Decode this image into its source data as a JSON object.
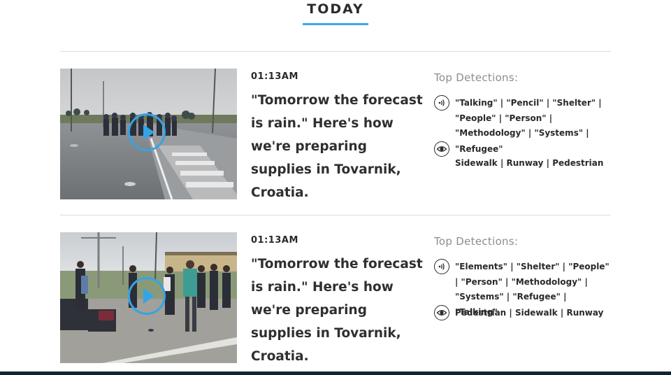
{
  "section": {
    "heading": "TODAY"
  },
  "cards": [
    {
      "time": "01:13AM",
      "title": "\"Tomorrow the forecast is rain.\" Here's how we're preparing supplies in Tovarnik, Croatia.",
      "detections_heading": "Top Detections:",
      "audio_detections": "\"Talking\" | \"Pencil\" | \"Shelter\" | \"People\" | \"Person\" | \"Methodology\" | \"Systems\" |",
      "visual_detections": "\"Refugee\"",
      "extra_detections": "Sidewalk | Runway | Pedestrian"
    },
    {
      "time": "01:13AM",
      "title": "\"Tomorrow the forecast is rain.\" Here's how we're preparing supplies in Tovarnik, Croatia.",
      "detections_heading": "Top Detections:",
      "audio_detections": "\"Elements\" | \"Shelter\" | \"People\" | \"Person\" | \"Methodology\" | \"Systems\" | \"Refugee\" | \"Talking\"",
      "visual_detections": "Pedestrian | Sidewalk | Runway"
    }
  ],
  "icons": {
    "audio": "audio-waves-icon",
    "visual": "eye-icon",
    "play": "play-icon"
  },
  "colors": {
    "accent": "#34a4e6",
    "text": "#2a2a2a",
    "muted": "#8d8d8d"
  }
}
